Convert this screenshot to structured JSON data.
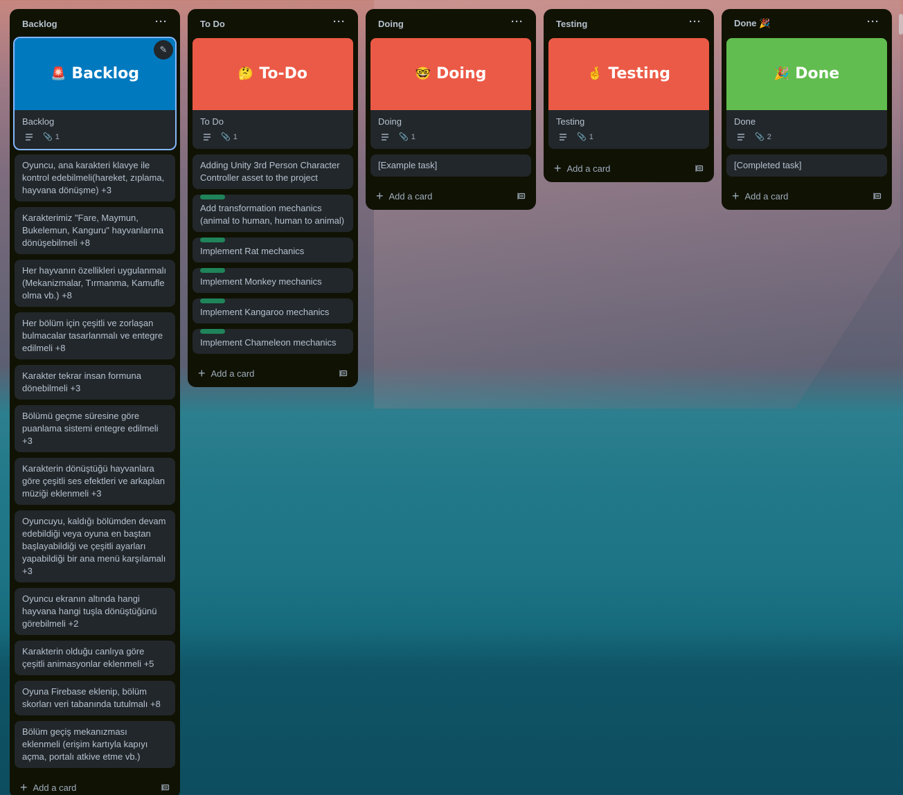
{
  "colors": {
    "list_bg": "#101204",
    "card_bg": "#22272b",
    "text": "#b6c2cf",
    "muted": "#9fadbc",
    "label_green": "#1f845a",
    "cover_blue": "#0079bf",
    "cover_red": "#eb5a46",
    "cover_green": "#61bd4f",
    "selected_outline": "#85b8ff"
  },
  "lists": [
    {
      "title": "Backlog",
      "menu": "···",
      "cover": {
        "emoji": "🚨",
        "title": "Backlog",
        "color": "#0079bf",
        "icon": "rotating-light-emoji"
      },
      "cover_card": {
        "title": "Backlog",
        "attachments": "1"
      },
      "cards": [
        "Oyuncu, ana karakteri klavye ile kontrol edebilmeli(hareket, zıplama, hayvana dönüşme) +3",
        "Karakterimiz \"Fare, Maymun, Bukelemun, Kanguru\" hayvanlarına dönüşebilmeli +8",
        "Her hayvanın özellikleri uygulanmalı (Mekanizmalar, Tırmanma, Kamufle olma vb.) +8",
        "Her bölüm için çeşitli ve zorlaşan bulmacalar tasarlanmalı ve entegre edilmeli +8",
        "Karakter tekrar insan formuna dönebilmeli +3",
        "Bölümü geçme süresine göre puanlama sistemi entegre edilmeli +3",
        "Karakterin dönüştüğü hayvanlara göre çeşitli ses efektleri ve arkaplan müziği eklenmeli +3",
        "Oyuncuyu, kaldığı bölümden devam edebildiği veya oyuna en baştan başlayabildiği ve çeşitli ayarları yapabildiği bir ana menü karşılamalı +3",
        "Oyuncu ekranın altında hangi hayvana hangi tuşla dönüştüğünü görebilmeli +2",
        "Karakterin olduğu canlıya göre çeşitli animasyonlar eklenmeli +5",
        "Oyuna Firebase eklenip, bölüm skorları veri tabanında tutulmalı +8",
        "Bölüm geçiş mekanızması eklenmeli (erişim kartıyla kapıyı açma, portalı atkive etme vb.)"
      ],
      "add_label": "Add a card"
    },
    {
      "title": "To Do",
      "menu": "···",
      "cover": {
        "emoji": "🤔",
        "title": "To-Do",
        "color": "#eb5a46",
        "icon": "thinking-face-emoji"
      },
      "cover_card": {
        "title": "To Do",
        "attachments": "1"
      },
      "cards": [
        "Adding Unity 3rd Person Character Controller asset to the project"
      ],
      "label_cards": [
        "Add transformation mechanics (animal to human, human to animal)",
        "Implement Rat mechanics",
        "Implement Monkey mechanics",
        "Implement Kangaroo mechanics",
        "Implement Chameleon mechanics"
      ],
      "add_label": "Add a card"
    },
    {
      "title": "Doing",
      "menu": "···",
      "cover": {
        "emoji": "🤓",
        "title": "Doing",
        "color": "#eb5a46",
        "icon": "nerd-face-emoji"
      },
      "cover_card": {
        "title": "Doing",
        "attachments": "1"
      },
      "cards": [
        "[Example task]"
      ],
      "add_label": "Add a card"
    },
    {
      "title": "Testing",
      "menu": "···",
      "cover": {
        "emoji": "🤞",
        "title": "Testing",
        "color": "#eb5a46",
        "icon": "crossed-fingers-emoji"
      },
      "cover_card": {
        "title": "Testing",
        "attachments": "1"
      },
      "cards": [],
      "add_label": "Add a card"
    },
    {
      "title": "Done 🎉",
      "menu": "···",
      "cover": {
        "emoji": "🎉",
        "title": "Done",
        "color": "#61bd4f",
        "icon": "party-popper-emoji"
      },
      "cover_card": {
        "title": "Done",
        "attachments": "2"
      },
      "cards": [
        "[Completed task]"
      ],
      "add_label": "Add a card"
    }
  ]
}
